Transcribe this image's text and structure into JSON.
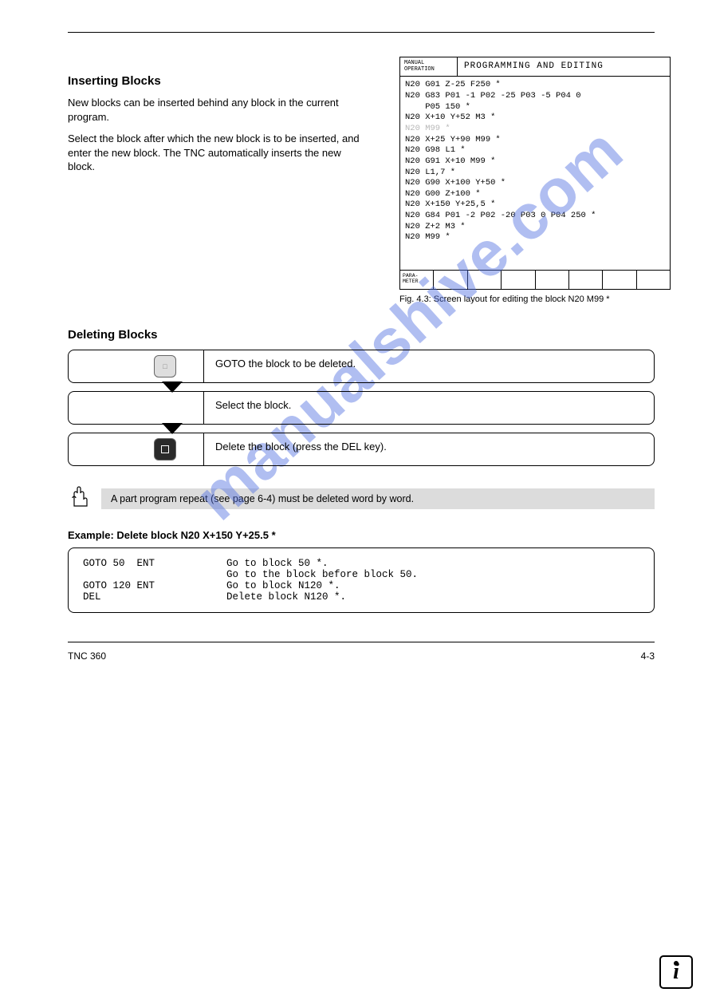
{
  "header_rule": true,
  "section": {
    "title": "Inserting Blocks",
    "p1": "New blocks can be inserted behind any block in the current program.",
    "p2": "Select the block after which the new block is to be inserted, and enter the new block. The TNC automatically inserts the new block.",
    "subhead": "Fig. 4.3: Screen layout for editing the block N20 M99 *"
  },
  "screen": {
    "mode": "MANUAL\nOPERATION",
    "title": "PROGRAMMING AND EDITING",
    "lines": [
      "N20 G01 Z-25 F250 *",
      "N20 G83 P01 -1 P02 -25 P03 -5 P04 0",
      "    P05 150 *",
      "N20 X+10 Y+52 M3 *",
      "N20 M99 *",
      "N20 X+25 Y+90 M99 *",
      "N20 G98 L1 *",
      "N20 G91 X+10 M99 *",
      "N20 L1,7 *",
      "N20 G90 X+100 Y+50 *",
      "N20 G00 Z+100 *",
      "N20 X+150 Y+25,5 *",
      "N20 G84 P01 -2 P02 -20 P03 0 P04 250 *",
      "N20 Z+2 M3 *",
      "N20 M99 *"
    ],
    "grey_line_index": 4,
    "softkeys": [
      "PARA-\nMETER",
      "",
      "",
      "",
      "",
      "",
      "",
      ""
    ]
  },
  "deleting": {
    "title": "Deleting Blocks"
  },
  "steps": [
    {
      "key": "goto",
      "key_glyph": "GOTO",
      "text": "GOTO the block to be deleted."
    },
    {
      "key": "none",
      "text": "Select the block."
    },
    {
      "key": "del",
      "text": "Delete the block (press the DEL key)."
    }
  ],
  "note": {
    "text": "A part program repeat (see page 6-4) must be deleted word by word."
  },
  "example": {
    "title": "Example: Delete block N20 X+150 Y+25.5 *",
    "rows": [
      {
        "c1": "GOTO 50  ENT",
        "c2": "Go to block 50 *."
      },
      {
        "c1": "",
        "c2": "Go to the block before block 50."
      },
      {
        "c1": "GOTO 120 ENT",
        "c2": "Go to block N120 *."
      },
      {
        "c1": "DEL",
        "c2": "Delete block N120 *."
      }
    ]
  },
  "footer": {
    "left": "TNC 360",
    "right": "4-3"
  },
  "corner_glyph": "i"
}
